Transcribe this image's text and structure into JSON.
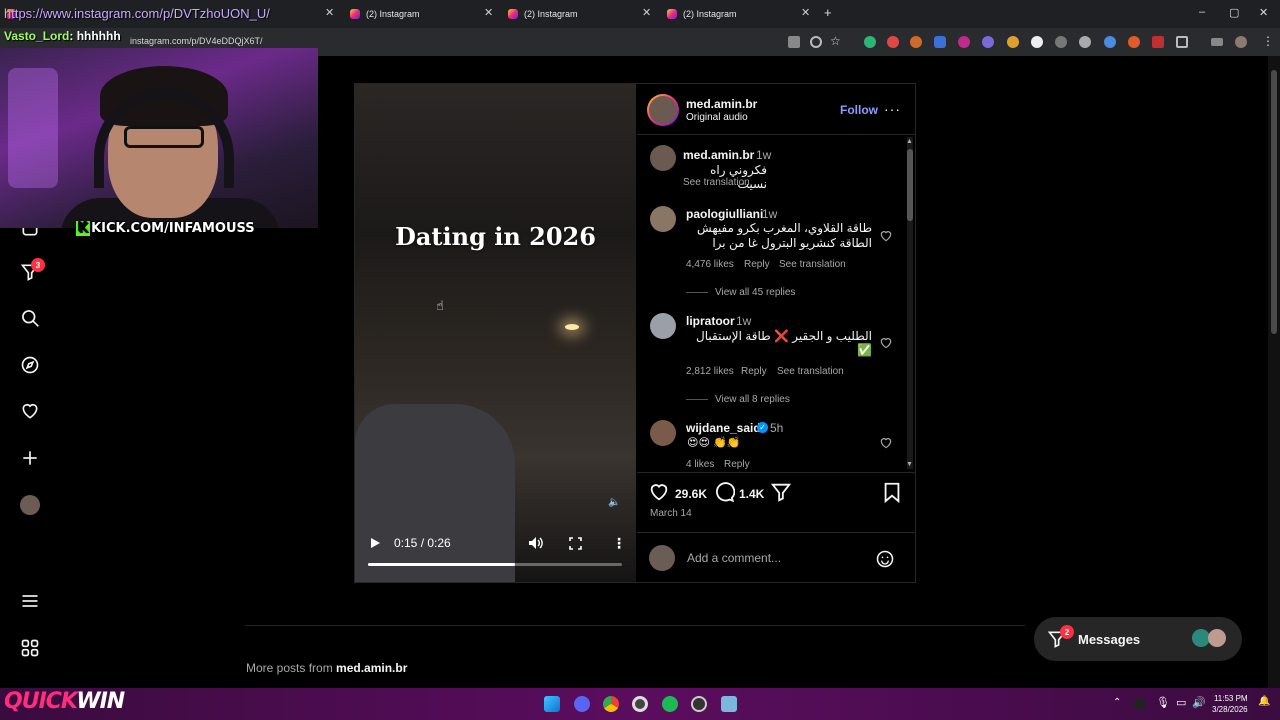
{
  "browser": {
    "tabs": [
      {
        "label": "https://www.instagram.com/p/DVTzhoUON_U/"
      },
      {
        "label": "(2) Instagram"
      },
      {
        "label": "(2) Instagram"
      },
      {
        "label": "(2) Instagram"
      }
    ],
    "address": "instagram.com/p/DV4eDDQjX6T/"
  },
  "stream_overlay": {
    "chat_user": "Vasto_Lord",
    "chat_text": ": hhhhhh",
    "kick_handle": "KICK.COM/INFAMOUSS",
    "kick_logo": "K"
  },
  "nav": {
    "notifications_badge": "3"
  },
  "post": {
    "author": "med.amin.br",
    "audio": "Original audio",
    "follow_label": "Follow",
    "more_label": "···",
    "video_title": "Dating in 2026",
    "video_time": "0:15 / 0:26",
    "video_progress": 0.58,
    "caption": {
      "user": "med.amin.br",
      "age": "1w",
      "text": "فكروني راه نسيت",
      "see_translation": "See translation"
    },
    "comments": [
      {
        "user": "paologiulliani",
        "age": "1w",
        "text_line1": "طاقة القلاوي، المغرب بكرو مفيهش",
        "text_line2": "الطاقة كنشريو البترول غا من برا",
        "likes": "4,476 likes",
        "reply": "Reply",
        "see_translation": "See translation",
        "view_replies": "View all 45 replies"
      },
      {
        "user": "lipratoor",
        "age": "1w",
        "text_line1": "الطليب و الجقير ❌ طاقة الإستقبال",
        "text_line2": "✅",
        "likes": "2,812 likes",
        "reply": "Reply",
        "see_translation": "See translation",
        "view_replies": "View all 8 replies"
      },
      {
        "user": "wijdane_said",
        "age": "5h",
        "verified": true,
        "text": "😍😍 👏👏",
        "likes": "4 likes",
        "reply": "Reply"
      }
    ],
    "likes": "29.6K",
    "comments_count": "1.4K",
    "date": "March 14",
    "comment_placeholder": "Add a comment..."
  },
  "footer": {
    "more_posts_prefix": "More posts from ",
    "more_posts_user": "med.amin.br"
  },
  "messages": {
    "label": "Messages",
    "badge": "2"
  },
  "taskbar": {
    "brand_part1": "QUICK",
    "brand_part2": "WIN",
    "time": "11:53 PM",
    "date": "3/28/2026"
  }
}
